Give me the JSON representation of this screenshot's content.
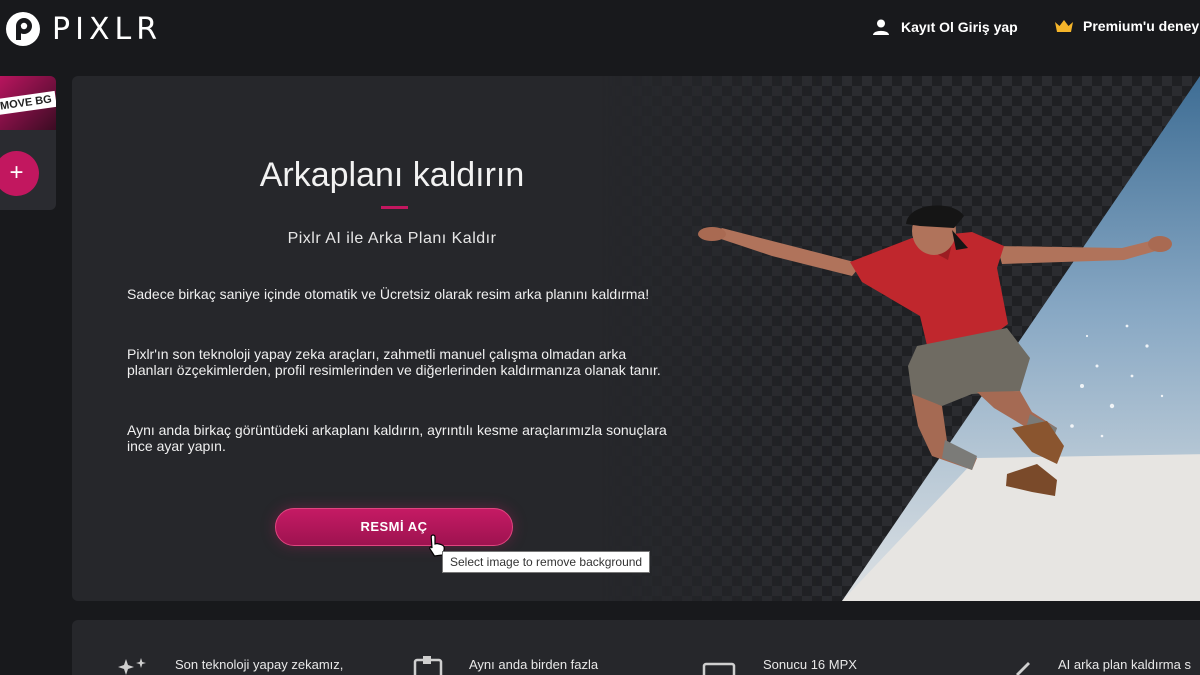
{
  "brand": {
    "name": "PIXLR"
  },
  "header": {
    "auth_label": "Kayıt Ol Giriş yap",
    "premium_label": "Premium'u deney"
  },
  "sidebar": {
    "thumb_label": "MOVE BG",
    "add_label": "+"
  },
  "hero": {
    "title": "Arkaplanı kaldırın",
    "subtitle": "Pixlr AI ile Arka Planı Kaldır",
    "paragraphs": [
      "Sadece birkaç saniye içinde otomatik ve Ücretsiz olarak resim arka planını kaldırma!",
      "Pixlr'ın son teknoloji yapay zeka araçları, zahmetli manuel çalışma olmadan arka planları özçekimlerden, profil resimlerinden ve diğerlerinden kaldırmanıza olanak tanır.",
      "Aynı anda birkaç görüntüdeki arkaplanı kaldırın, ayrıntılı kesme araçlarımızla sonuçlara ince ayar yapın."
    ],
    "open_button": "RESMİ AÇ",
    "tooltip": "Select image to remove background"
  },
  "features": [
    {
      "label": "Son teknoloji yapay zekamız,",
      "icon": "sparkles-icon"
    },
    {
      "label": "Aynı anda birden fazla",
      "icon": "stack-icon"
    },
    {
      "label": "Sonucu 16 MPX",
      "icon": "monitor-icon"
    },
    {
      "label": "AI arka plan kaldırma s",
      "icon": "pen-icon"
    }
  ],
  "colors": {
    "accent": "#c2175f",
    "background": "#18191c",
    "card": "#26272b"
  }
}
